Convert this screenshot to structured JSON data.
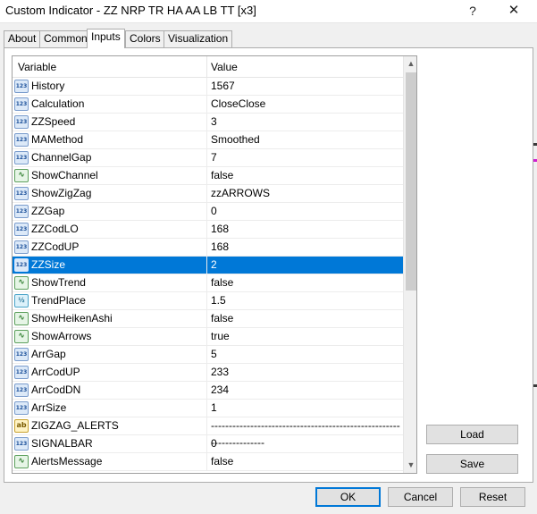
{
  "window": {
    "title": "Custom Indicator - ZZ NRP TR HA AA LB TT [x3]",
    "help_glyph": "?",
    "close_glyph": "✕"
  },
  "tabs": [
    {
      "label": "About",
      "active": false
    },
    {
      "label": "Common",
      "active": false
    },
    {
      "label": "Inputs",
      "active": true
    },
    {
      "label": "Colors",
      "active": false
    },
    {
      "label": "Visualization",
      "active": false
    }
  ],
  "grid": {
    "header_variable": "Variable",
    "header_value": "Value",
    "rows": [
      {
        "type": "int",
        "name": "History",
        "value": "1567"
      },
      {
        "type": "int",
        "name": "Calculation",
        "value": "CloseClose"
      },
      {
        "type": "int",
        "name": "ZZSpeed",
        "value": "3"
      },
      {
        "type": "int",
        "name": "MAMethod",
        "value": "Smoothed"
      },
      {
        "type": "int",
        "name": "ChannelGap",
        "value": "7"
      },
      {
        "type": "bool",
        "name": "ShowChannel",
        "value": "false"
      },
      {
        "type": "int",
        "name": "ShowZigZag",
        "value": "zzARROWS"
      },
      {
        "type": "int",
        "name": "ZZGap",
        "value": "0"
      },
      {
        "type": "int",
        "name": "ZZCodLO",
        "value": "168"
      },
      {
        "type": "int",
        "name": "ZZCodUP",
        "value": "168"
      },
      {
        "type": "int",
        "name": "ZZSize",
        "value": "2",
        "selected": true
      },
      {
        "type": "bool",
        "name": "ShowTrend",
        "value": "false"
      },
      {
        "type": "double",
        "name": "TrendPlace",
        "value": "1.5"
      },
      {
        "type": "bool",
        "name": "ShowHeikenAshi",
        "value": "false"
      },
      {
        "type": "bool",
        "name": "ShowArrows",
        "value": "true"
      },
      {
        "type": "int",
        "name": "ArrGap",
        "value": "5"
      },
      {
        "type": "int",
        "name": "ArrCodUP",
        "value": "233"
      },
      {
        "type": "int",
        "name": "ArrCodDN",
        "value": "234"
      },
      {
        "type": "int",
        "name": "ArrSize",
        "value": "1"
      },
      {
        "type": "string",
        "name": "ZIGZAG_ALERTS",
        "value": "--------------------------------------------------------------------"
      },
      {
        "type": "int",
        "name": "SIGNALBAR",
        "value": "0"
      },
      {
        "type": "bool",
        "name": "AlertsMessage",
        "value": "false"
      }
    ]
  },
  "icons": {
    "int": "123",
    "bool": "∿",
    "double": "½",
    "string": "ab"
  },
  "scrollbar": {
    "up_glyph": "▲",
    "down_glyph": "▼"
  },
  "buttons": {
    "load": "Load",
    "save": "Save",
    "ok": "OK",
    "cancel": "Cancel",
    "reset": "Reset"
  },
  "colors": {
    "selection": "#0078d7",
    "accent": "#0078d7"
  }
}
